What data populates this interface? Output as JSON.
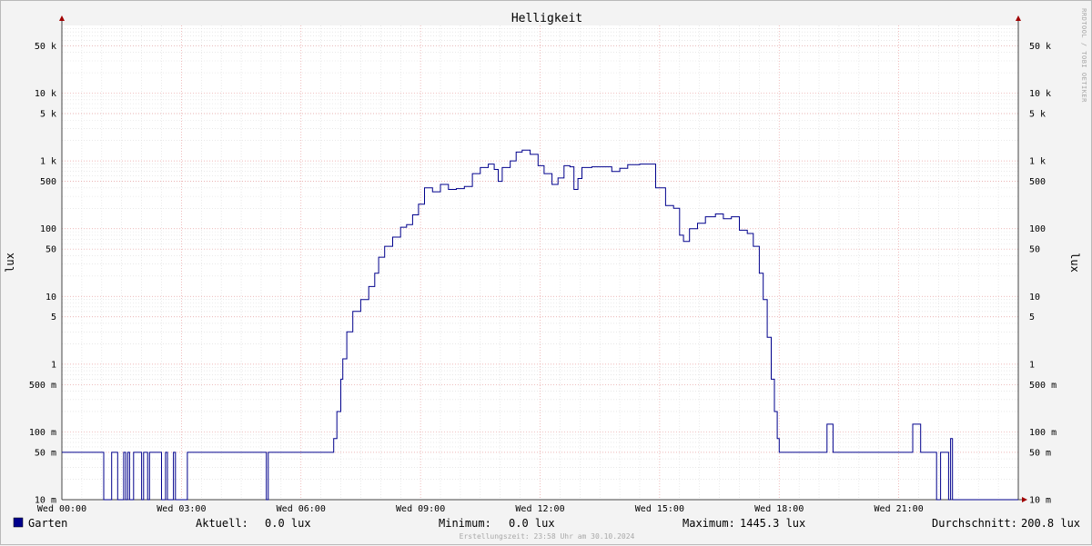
{
  "chart_data": {
    "type": "line",
    "title": "Helligkeit",
    "ylabel": "lux",
    "yscale": "log",
    "ylim": [
      0.01,
      100000
    ],
    "xlim_hours": [
      0,
      24
    ],
    "x_ticks": [
      {
        "hour": 0,
        "label": "Wed 00:00"
      },
      {
        "hour": 3,
        "label": "Wed 03:00"
      },
      {
        "hour": 6,
        "label": "Wed 06:00"
      },
      {
        "hour": 9,
        "label": "Wed 09:00"
      },
      {
        "hour": 12,
        "label": "Wed 12:00"
      },
      {
        "hour": 15,
        "label": "Wed 15:00"
      },
      {
        "hour": 18,
        "label": "Wed 18:00"
      },
      {
        "hour": 21,
        "label": "Wed 21:00"
      }
    ],
    "y_ticks": [
      {
        "value": 50000,
        "label": "50 k"
      },
      {
        "value": 10000,
        "label": "10 k"
      },
      {
        "value": 5000,
        "label": "5 k"
      },
      {
        "value": 1000,
        "label": "1 k"
      },
      {
        "value": 500,
        "label": "500"
      },
      {
        "value": 100,
        "label": "100"
      },
      {
        "value": 50,
        "label": "50"
      },
      {
        "value": 10,
        "label": "10"
      },
      {
        "value": 5,
        "label": "5"
      },
      {
        "value": 1,
        "label": "1"
      },
      {
        "value": 0.5,
        "label": "500 m"
      },
      {
        "value": 0.1,
        "label": "100 m"
      },
      {
        "value": 0.05,
        "label": "50 m"
      },
      {
        "value": 0.01,
        "label": "10 m"
      }
    ],
    "grid": true,
    "series": [
      {
        "name": "Garten",
        "color": "#00008c",
        "points": [
          [
            0,
            0.05
          ],
          [
            0.5,
            0.05
          ],
          [
            1.0,
            0.05
          ],
          [
            1.05,
            0.01
          ],
          [
            1.2,
            0.01
          ],
          [
            1.25,
            0.05
          ],
          [
            1.35,
            0.05
          ],
          [
            1.4,
            0.01
          ],
          [
            1.5,
            0.01
          ],
          [
            1.55,
            0.05
          ],
          [
            1.6,
            0.01
          ],
          [
            1.65,
            0.05
          ],
          [
            1.7,
            0.01
          ],
          [
            1.75,
            0.01
          ],
          [
            1.8,
            0.05
          ],
          [
            1.95,
            0.05
          ],
          [
            2.0,
            0.01
          ],
          [
            2.05,
            0.05
          ],
          [
            2.15,
            0.01
          ],
          [
            2.2,
            0.05
          ],
          [
            2.45,
            0.05
          ],
          [
            2.5,
            0.01
          ],
          [
            2.55,
            0.01
          ],
          [
            2.6,
            0.05
          ],
          [
            2.65,
            0.01
          ],
          [
            2.7,
            0.01
          ],
          [
            2.8,
            0.05
          ],
          [
            2.85,
            0.01
          ],
          [
            3.1,
            0.01
          ],
          [
            3.15,
            0.05
          ],
          [
            5.1,
            0.05
          ],
          [
            5.13,
            0.01
          ],
          [
            5.18,
            0.05
          ],
          [
            6.75,
            0.05
          ],
          [
            6.82,
            0.08
          ],
          [
            6.9,
            0.2
          ],
          [
            7.0,
            0.6
          ],
          [
            7.05,
            1.2
          ],
          [
            7.15,
            3
          ],
          [
            7.3,
            6
          ],
          [
            7.5,
            9
          ],
          [
            7.7,
            14
          ],
          [
            7.85,
            22
          ],
          [
            7.95,
            38
          ],
          [
            8.1,
            55
          ],
          [
            8.3,
            75
          ],
          [
            8.5,
            105
          ],
          [
            8.65,
            115
          ],
          [
            8.8,
            160
          ],
          [
            8.95,
            230
          ],
          [
            9.1,
            400
          ],
          [
            9.3,
            350
          ],
          [
            9.5,
            450
          ],
          [
            9.7,
            380
          ],
          [
            9.9,
            390
          ],
          [
            10.1,
            420
          ],
          [
            10.3,
            650
          ],
          [
            10.5,
            800
          ],
          [
            10.7,
            900
          ],
          [
            10.85,
            750
          ],
          [
            10.95,
            500
          ],
          [
            11.05,
            800
          ],
          [
            11.25,
            1000
          ],
          [
            11.4,
            1350
          ],
          [
            11.55,
            1445
          ],
          [
            11.75,
            1250
          ],
          [
            11.95,
            850
          ],
          [
            12.1,
            650
          ],
          [
            12.3,
            450
          ],
          [
            12.45,
            560
          ],
          [
            12.6,
            850
          ],
          [
            12.75,
            820
          ],
          [
            12.85,
            380
          ],
          [
            12.95,
            550
          ],
          [
            13.05,
            800
          ],
          [
            13.3,
            820
          ],
          [
            13.6,
            820
          ],
          [
            13.8,
            700
          ],
          [
            14.0,
            780
          ],
          [
            14.2,
            880
          ],
          [
            14.5,
            900
          ],
          [
            14.7,
            900
          ],
          [
            14.9,
            400
          ],
          [
            15.15,
            220
          ],
          [
            15.35,
            200
          ],
          [
            15.5,
            80
          ],
          [
            15.6,
            65
          ],
          [
            15.75,
            100
          ],
          [
            15.95,
            120
          ],
          [
            16.15,
            150
          ],
          [
            16.4,
            165
          ],
          [
            16.6,
            140
          ],
          [
            16.8,
            150
          ],
          [
            17.0,
            95
          ],
          [
            17.2,
            85
          ],
          [
            17.35,
            55
          ],
          [
            17.5,
            22
          ],
          [
            17.6,
            9
          ],
          [
            17.7,
            2.5
          ],
          [
            17.8,
            0.6
          ],
          [
            17.88,
            0.2
          ],
          [
            17.95,
            0.08
          ],
          [
            18.0,
            0.05
          ],
          [
            19.15,
            0.05
          ],
          [
            19.2,
            0.13
          ],
          [
            19.3,
            0.13
          ],
          [
            19.35,
            0.05
          ],
          [
            21.3,
            0.05
          ],
          [
            21.35,
            0.13
          ],
          [
            21.45,
            0.13
          ],
          [
            21.55,
            0.05
          ],
          [
            21.9,
            0.05
          ],
          [
            21.95,
            0.01
          ],
          [
            22.05,
            0.05
          ],
          [
            22.2,
            0.05
          ],
          [
            22.25,
            0.01
          ],
          [
            22.3,
            0.08
          ],
          [
            22.35,
            0.01
          ],
          [
            24.0,
            0.01
          ]
        ]
      }
    ],
    "legend": {
      "name": "Garten",
      "current_label": "Aktuell:",
      "current_value": "0.0 lux",
      "min_label": "Minimum:",
      "min_value": "0.0 lux",
      "max_label": "Maximum:",
      "max_value": "1445.3 lux",
      "avg_label": "Durchschnitt:",
      "avg_value": "200.8 lux"
    },
    "watermark": "RRDTOOL / TOBI OETIKER",
    "footer": "Erstellungszeit: 23:58 Uhr am 30.10.2024"
  }
}
